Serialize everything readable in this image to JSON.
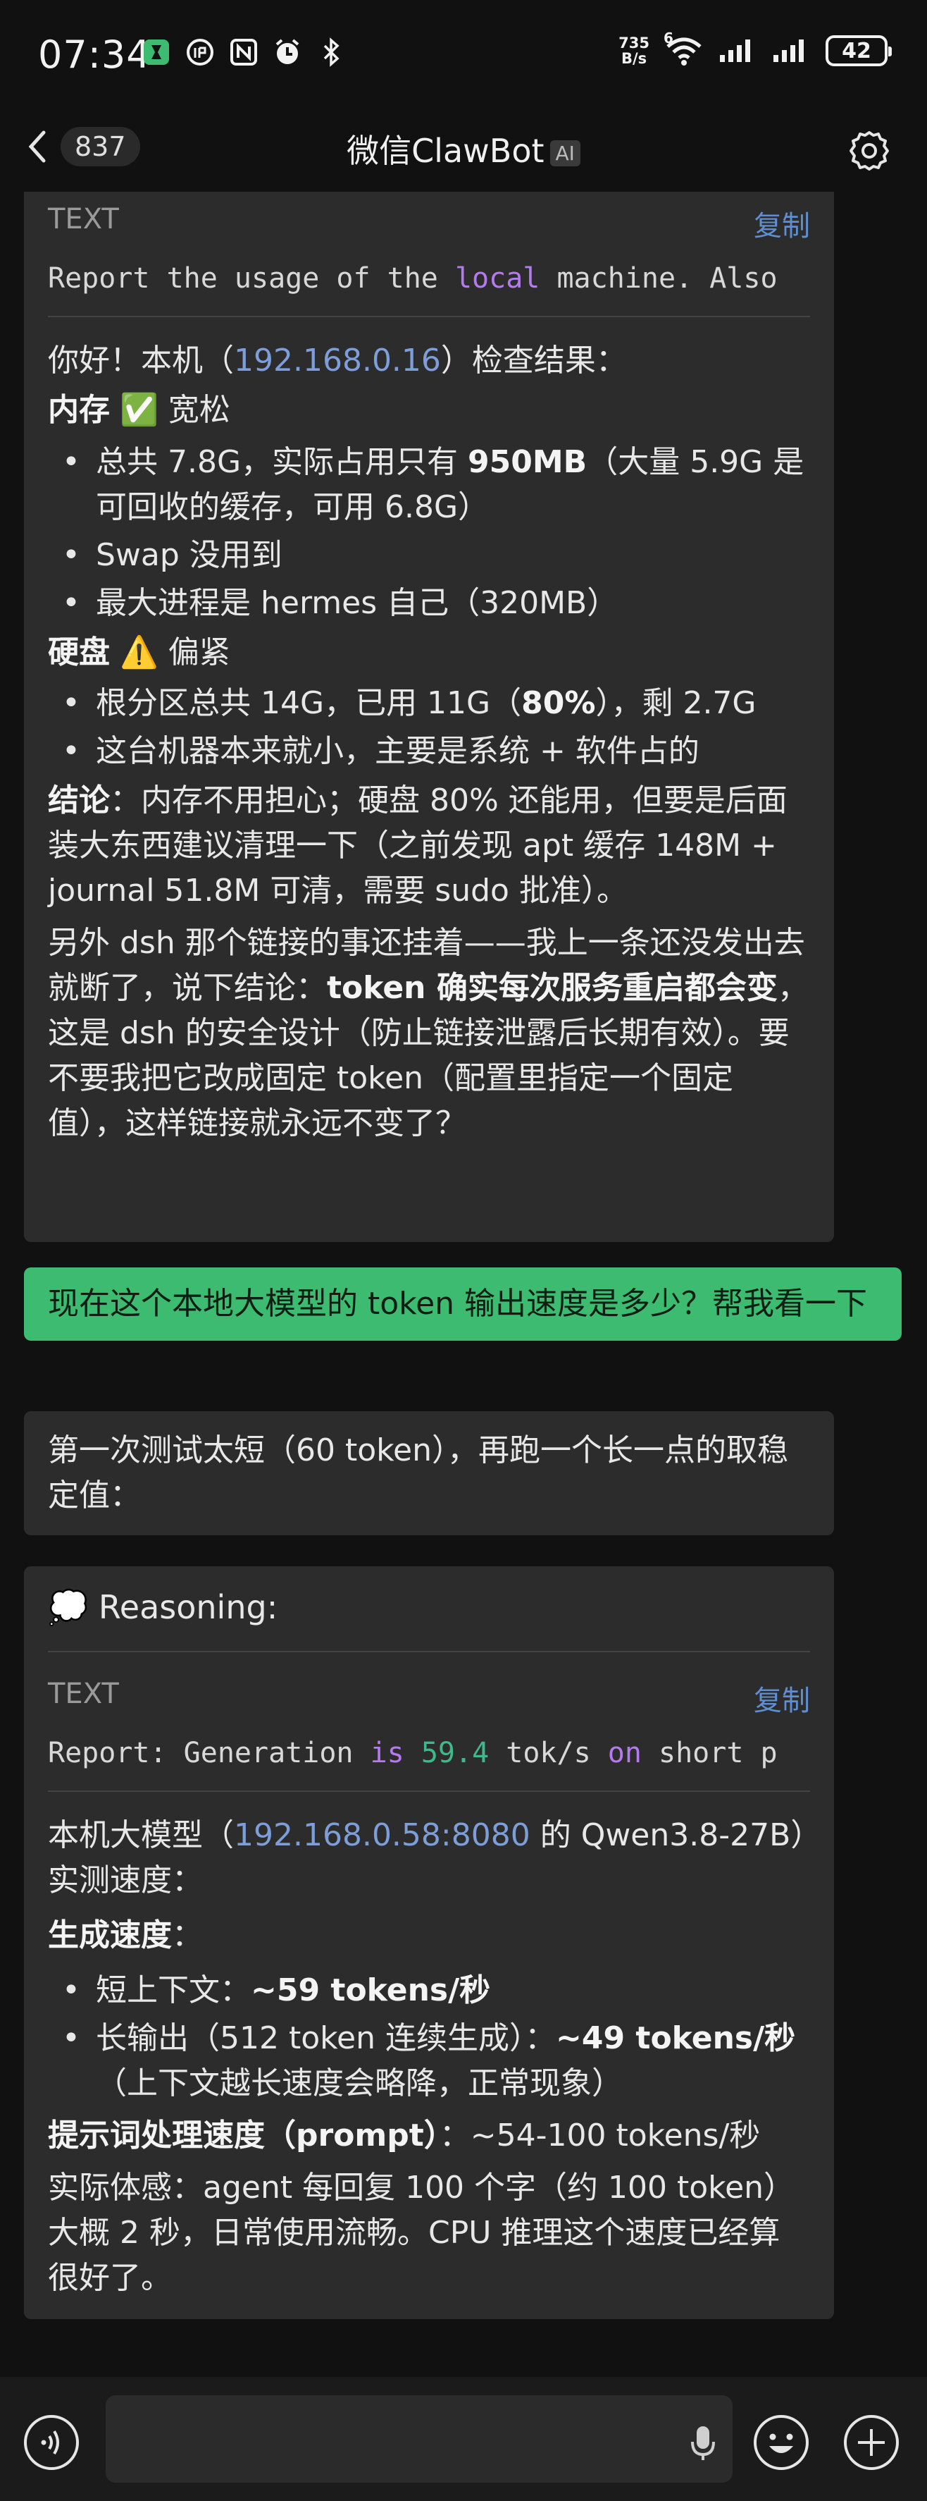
{
  "status_bar": {
    "time": "07:34",
    "net_speed_value": "735",
    "net_speed_unit": "B/s",
    "wifi_badge": "6",
    "battery": "42",
    "icons": [
      "app-notification-icon",
      "clock-badge-icon",
      "nfc-icon",
      "alarm-icon",
      "bluetooth-icon",
      "wifi-icon",
      "signal-icon",
      "signal-icon",
      "battery-icon"
    ]
  },
  "header": {
    "back_count": "837",
    "title": "微信ClawBot",
    "ai_badge": "AI"
  },
  "messages": {
    "m1": {
      "code_label": "TEXT",
      "copy": "复制",
      "code_parts": [
        "Report the usage of the ",
        "local",
        " machine. Also"
      ],
      "intro_1": "你好！本机（",
      "ip": "192.168.0.16",
      "intro_2": "）检查结果：",
      "memory_title": "内存",
      "memory_emoji": "✅",
      "memory_status": "宽松",
      "memory_items": [
        {
          "pre": "总共 7.8G，实际占用只有 ",
          "bold": "950MB",
          "post": "（大量 5.9G 是可回收的缓存，可用 6.8G）"
        },
        {
          "pre": "Swap 没用到",
          "bold": "",
          "post": ""
        },
        {
          "pre": "最大进程是 hermes 自己（320MB）",
          "bold": "",
          "post": ""
        }
      ],
      "disk_title": "硬盘",
      "disk_emoji": "⚠️",
      "disk_status": "偏紧",
      "disk_items": [
        {
          "pre": "根分区总共 14G，已用 11G（",
          "bold": "80%",
          "post": "），剩 2.7G"
        },
        {
          "pre": "这台机器本来就小，主要是系统 + 软件占的",
          "bold": "",
          "post": ""
        }
      ],
      "conclusion_label": "结论",
      "conclusion_text": "：内存不用担心；硬盘 80% 还能用，但要是后面装大东西建议清理一下（之前发现 apt 缓存 148M + journal 51.8M 可清，需要 sudo 批准）。",
      "extra_pre": "另外 dsh 那个链接的事还挂着——我上一条还没发出去就断了，说下结论：",
      "extra_bold": "token 确实每次服务重启都会变",
      "extra_post": "，这是 dsh 的安全设计（防止链接泄露后长期有效）。要不要我把它改成固定 token（配置里指定一个固定值），这样链接就永远不变了？"
    },
    "m2_user": "现在这个本地大模型的 token 输出速度是多少？帮我看一下",
    "m3": "第一次测试太短（60 token），再跑一个长一点的取稳定值：",
    "m4": {
      "reasoning_emoji": "💭",
      "reasoning_label": "Reasoning:",
      "code_label": "TEXT",
      "copy": "复制",
      "code_parts": [
        "Report: Generation ",
        "is",
        " ",
        "59.4",
        " tok/s ",
        "on",
        " short p"
      ],
      "intro_1": "本机大模型（",
      "host": "192.168.0.58:8080",
      "intro_2": " 的 Qwen3.8-27B）实测速度：",
      "gen_title": "生成速度",
      "gen_colon": "：",
      "gen_items": [
        {
          "pre": "短上下文：",
          "bold": "~59 tokens/秒",
          "post": ""
        },
        {
          "pre": "长输出（512 token 连续生成）：",
          "bold": "~49 tokens/秒",
          "post": "（上下文越长速度会略降，正常现象）"
        }
      ],
      "prompt_title": "提示词处理速度（prompt）",
      "prompt_value": "：~54-100 tokens/秒",
      "feel": "实际体感：agent 每回复 100 个字（约 100 token）大概 2 秒，日常使用流畅。CPU 推理这个速度已经算很好了。"
    }
  },
  "input": {
    "placeholder": ""
  }
}
